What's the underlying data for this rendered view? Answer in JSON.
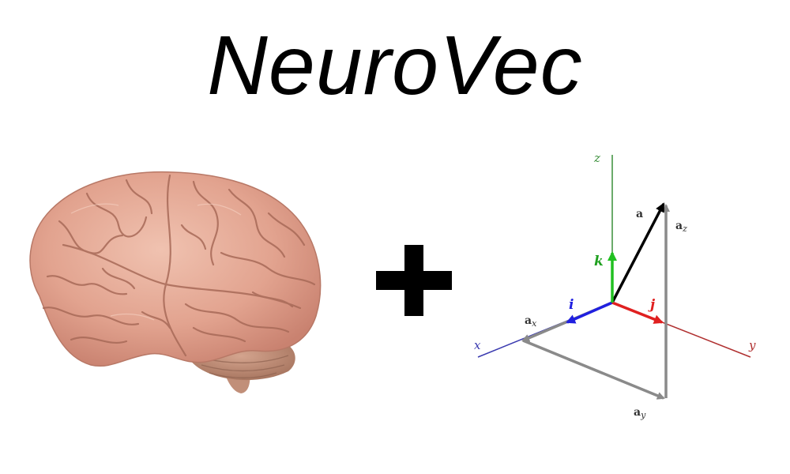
{
  "title": "NeuroVec",
  "images": {
    "brain": "brain-illustration",
    "plus": "plus-icon",
    "axes": "vector-axes-diagram"
  },
  "diagram": {
    "axis_labels": {
      "x": "x",
      "y": "y",
      "z": "z"
    },
    "unit_vectors": {
      "i": "i",
      "j": "j",
      "k": "k"
    },
    "vector_label": "a",
    "component_labels": {
      "ax_base": "a",
      "ax_sub": "x",
      "ay_base": "a",
      "ay_sub": "y",
      "az_base": "a",
      "az_sub": "z"
    },
    "colors": {
      "x_axis": "#3b3bb0",
      "y_axis": "#b03030",
      "z_axis": "#3a8f3a",
      "i_vector": "#2020e0",
      "j_vector": "#e02020",
      "k_vector": "#20c020",
      "a_vector": "#000000",
      "components": "#8a8a8a"
    }
  }
}
